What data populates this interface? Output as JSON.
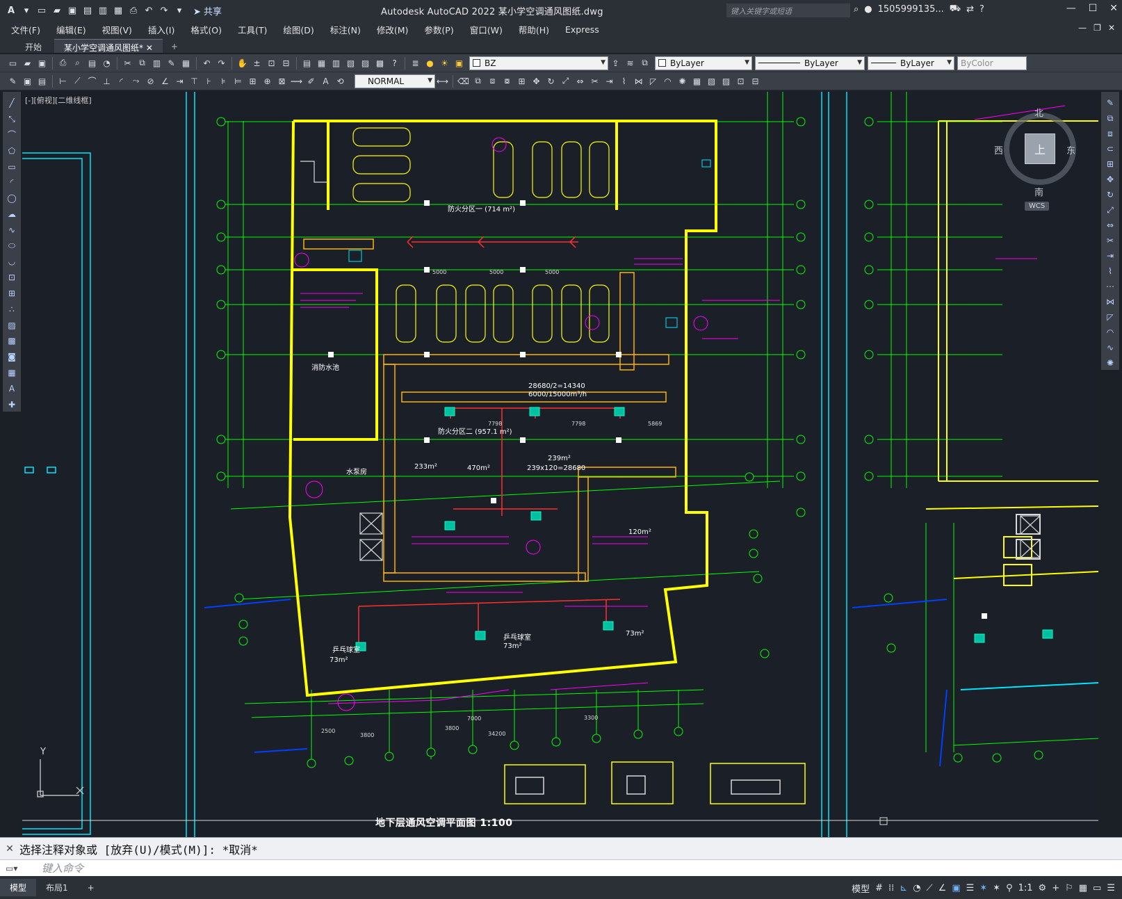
{
  "titlebar": {
    "logo": "A",
    "share_label": "共享",
    "app_title": "Autodesk AutoCAD 2022    某小学空调通风图纸.dwg",
    "search_placeholder": "键入关键字或短语",
    "user": "1505999135...",
    "help": "?"
  },
  "menu": [
    "文件(F)",
    "编辑(E)",
    "视图(V)",
    "插入(I)",
    "格式(O)",
    "工具(T)",
    "绘图(D)",
    "标注(N)",
    "修改(M)",
    "参数(P)",
    "窗口(W)",
    "帮助(H)",
    "Express"
  ],
  "tabs": [
    {
      "label": "开始",
      "active": false
    },
    {
      "label": "某小学空调通风图纸*",
      "active": true
    }
  ],
  "toolbar1": {
    "layer_value": "BZ",
    "color_value": "ByLayer",
    "linetype_value": "ByLayer",
    "lineweight_value": "ByLayer",
    "plotstyle_value": "ByColor"
  },
  "toolbar2": {
    "dimstyle_value": "NORMAL"
  },
  "viewport": {
    "label": "[-][俯视][二维线框]"
  },
  "viewcube": {
    "top": "上",
    "north": "北",
    "south": "南",
    "east": "东",
    "west": "西",
    "wcs": "WCS"
  },
  "ucs": {
    "y": "Y"
  },
  "drawing": {
    "title": "地下层通风空调平面图   1:100",
    "zone1": "防火分区一 (714 m²)",
    "zone2": "防火分区二 (957.1 m²)",
    "calc1": "28680/2=14340",
    "calc2": "6000/15000m³/h",
    "area1": "239m²",
    "area2": "239x120=28680",
    "area3": "233m²",
    "area4": "470m²",
    "area5": "120m²",
    "area6": "73m²",
    "room1": "消防水池",
    "room2": "水泵房",
    "room3": "乒乓球室",
    "dims": [
      "5000",
      "5000",
      "5000",
      "7798",
      "7798",
      "5869",
      "2500",
      "3800",
      "7000",
      "3800",
      "3300",
      "34200"
    ]
  },
  "command": {
    "history": "选择注释对象或 [放弃(U)/模式(M)]: *取消*",
    "input_placeholder": "键入命令"
  },
  "statusbar": {
    "tabs": [
      {
        "label": "模型",
        "active": true
      },
      {
        "label": "布局1",
        "active": false
      }
    ],
    "model_label": "模型",
    "scale": "1:1"
  },
  "colors": {
    "canvas_bg": "#1b1f27",
    "wall": "#ffff00",
    "grid": "#00ff00",
    "duct": "#ff00ff",
    "cyan": "#00e5ff",
    "red": "#ff3030"
  }
}
